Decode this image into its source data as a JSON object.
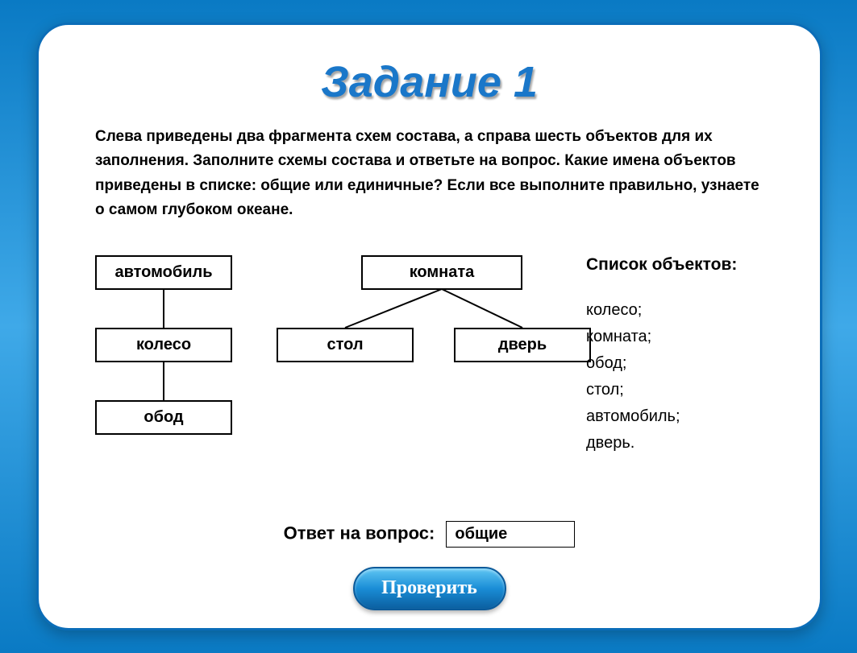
{
  "title": "Задание 1",
  "instructions": "Слева приведены два фрагмента схем состава, а справа шесть объектов для их заполнения. Заполните схемы состава и ответьте на вопрос. Какие имена объектов приведены в списке: общие или единичные? Если все выполните правильно, узнаете о самом глубоком океане.",
  "diagram": {
    "left": {
      "top": "автомобиль",
      "mid": "колесо",
      "bot": "обод"
    },
    "right": {
      "top": "комната",
      "childA": "стол",
      "childB": "дверь"
    }
  },
  "sidebar": {
    "title": "Список объектов:",
    "items": [
      "колесо;",
      "комната;",
      "обод;",
      "стол;",
      "автомобиль;",
      "дверь."
    ]
  },
  "answer": {
    "label": "Ответ на вопрос:",
    "value": "общие"
  },
  "button": {
    "check": "Проверить"
  }
}
